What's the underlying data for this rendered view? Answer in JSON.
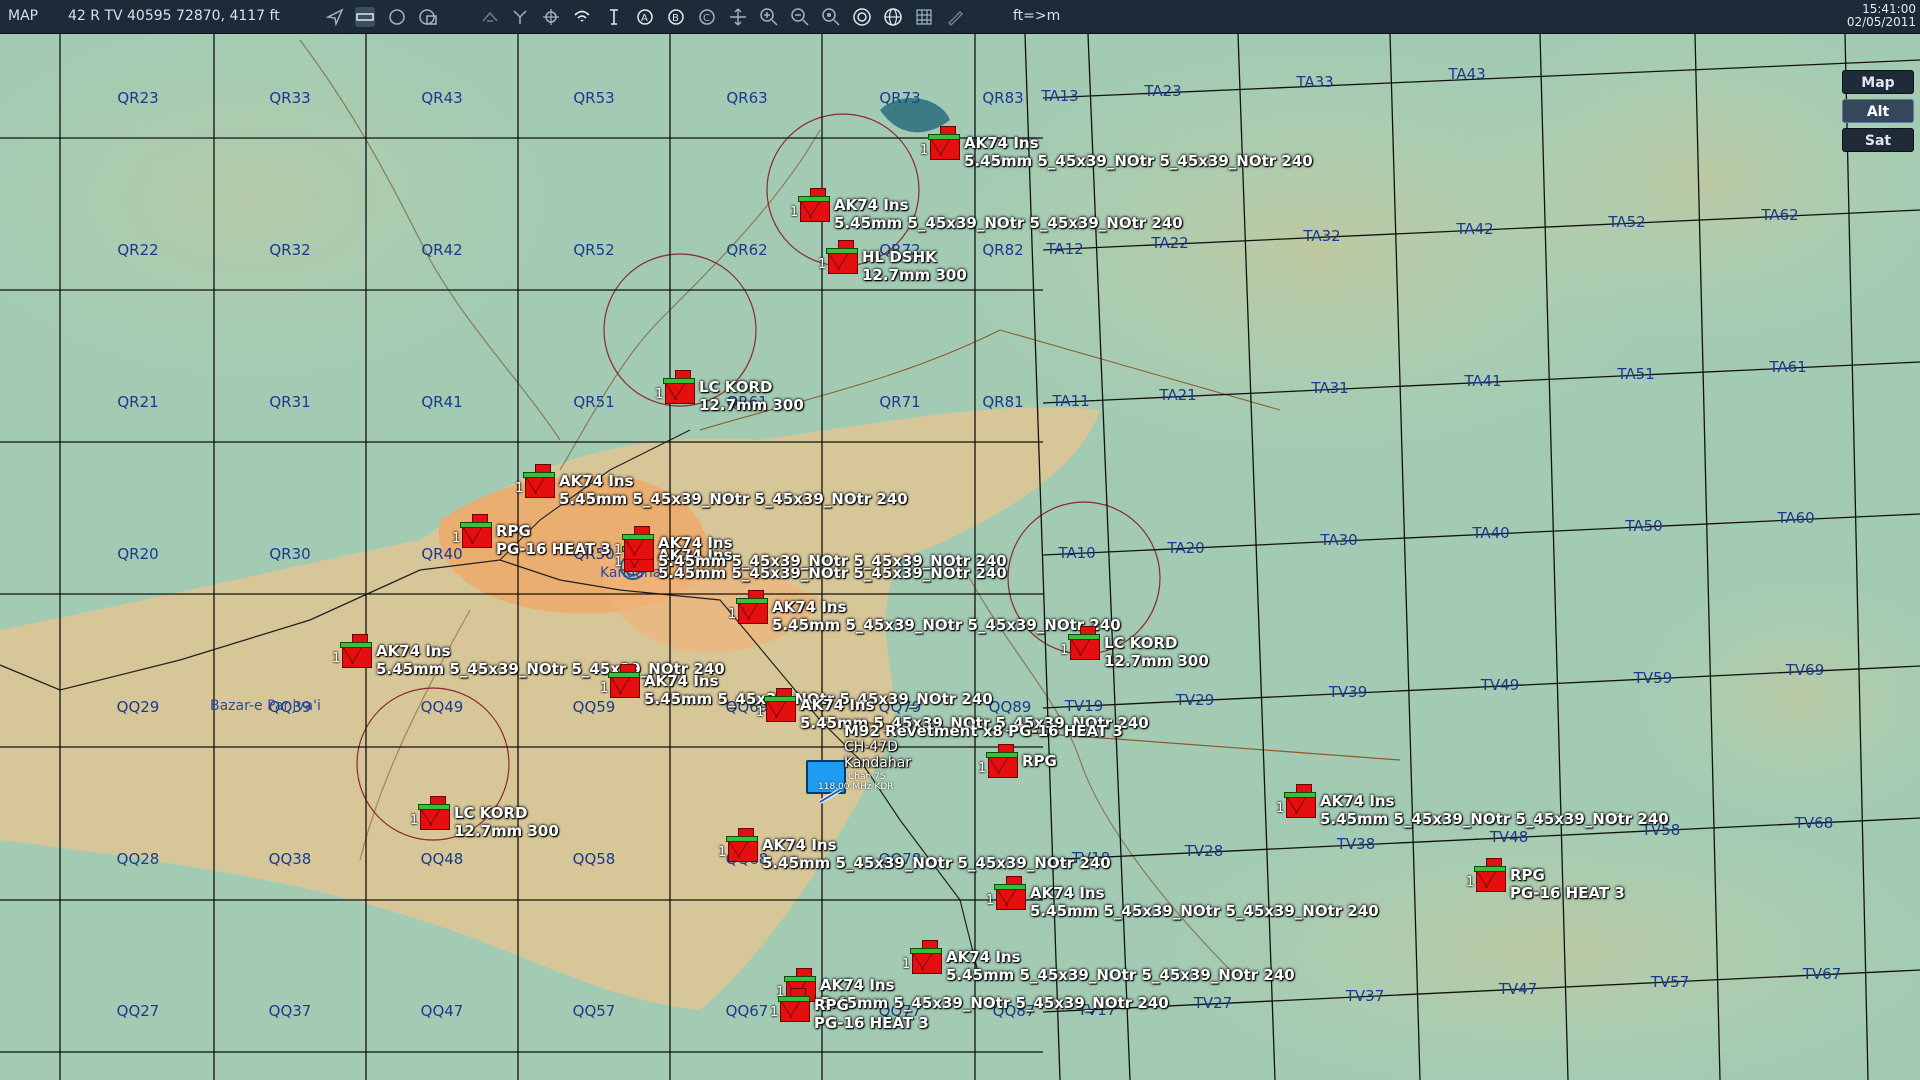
{
  "topbar": {
    "mode_label": "MAP",
    "coordinates": "42 R TV 40595 72870, 4117 ft",
    "units_toggle": "ft=>m",
    "time": "15:41:00",
    "date": "02/05/2011",
    "tool_icons": [
      "pointer-icon",
      "ruler-icon",
      "circle-icon",
      "polygon-icon",
      "aircraft-icon",
      "route-icon",
      "target-icon",
      "wifi-icon",
      "tower-icon",
      "layer-a-icon",
      "layer-b-icon",
      "layer-c-icon",
      "pan-icon",
      "zoom-in-icon",
      "zoom-out-icon",
      "zoom-fit-icon",
      "radar-icon",
      "globe-icon",
      "grid-icon",
      "pencil-icon"
    ]
  },
  "modes": {
    "map": "Map",
    "alt": "Alt",
    "sat": "Sat",
    "active": "Alt"
  },
  "grid_labels": [
    "QR23",
    "QR33",
    "QR43",
    "QR53",
    "QR63",
    "QR73",
    "QR83",
    "TA13",
    "TA23",
    "TA33",
    "TA43",
    "QR22",
    "QR32",
    "QR42",
    "QR52",
    "QR62",
    "QR72",
    "QR82",
    "TA12",
    "TA22",
    "TA32",
    "TA42",
    "TA52",
    "TA62",
    "QR21",
    "QR31",
    "QR41",
    "QR51",
    "QR61",
    "QR71",
    "QR81",
    "TA11",
    "TA21",
    "TA31",
    "TA41",
    "TA51",
    "TA61",
    "QR20",
    "QR30",
    "QR40",
    "QR50",
    "TA10",
    "TA20",
    "TA30",
    "TA40",
    "TA50",
    "TA60",
    "QQ29",
    "QQ39",
    "QQ49",
    "QQ59",
    "QQ69",
    "QQ79",
    "QQ89",
    "TV19",
    "TV29",
    "TV39",
    "TV49",
    "TV59",
    "TV69",
    "QQ28",
    "QQ38",
    "QQ48",
    "QQ58",
    "QQ68",
    "QQ78",
    "TV18",
    "TV28",
    "TV38",
    "TV48",
    "TV58",
    "TV68",
    "QQ27",
    "QQ37",
    "QQ47",
    "QQ57",
    "QQ67",
    "QQ77",
    "QQ87",
    "TV17",
    "TV27",
    "TV37",
    "TV47",
    "TV57",
    "TV67"
  ],
  "towns": {
    "kandahar_city": "Kandahar",
    "bazar": "Bazar-e Panjva'i"
  },
  "friendly": {
    "line1": "M92 Revetment x8 PG-16 HEAT 3",
    "line2": "CH-47D",
    "airport": "Kandahar",
    "freq1": "Chan 75",
    "freq2": "118.00 MHz KDR"
  },
  "units": [
    {
      "count": "1",
      "l1": "AK74 Ins",
      "l2": "5.45mm 5_45x39_NOtr 5_45x39_NOtr  240"
    },
    {
      "count": "1",
      "l1": "AK74 Ins",
      "l2": "5.45mm 5_45x39_NOtr 5_45x39_NOtr  240"
    },
    {
      "count": "1",
      "l1": "HL DSHK",
      "l2": "12.7mm 300"
    },
    {
      "count": "1",
      "l1": "LC KORD",
      "l2": "12.7mm 300"
    },
    {
      "count": "1",
      "l1": "AK74 Ins",
      "l2": "5.45mm 5_45x39_NOtr 5_45x39_NOtr  240"
    },
    {
      "count": "1",
      "l1": "RPG",
      "l2": "PG-16 HEAT 3"
    },
    {
      "count": "1",
      "l1": "AK74 Ins",
      "l2": "5.45mm 5_45x39_NOtr 5_45x39_NOtr  240"
    },
    {
      "count": "1",
      "l1": "AK74 Ins",
      "l2": "5.45mm 5_45x39_NOtr 5_45x39_NOtr  240"
    },
    {
      "count": "1",
      "l1": "LC KORD",
      "l2": "12.7mm 300"
    },
    {
      "count": "1",
      "l1": "AK74 Ins",
      "l2": "5.45mm 5_45x39_NOtr 5_45x39_NOtr  240"
    },
    {
      "count": "1",
      "l1": "AK74 Ins",
      "l2": "5.45mm 5_45x39_NOtr 5_45x39_NOtr  240"
    },
    {
      "count": "1",
      "l1": "AK74 Ins",
      "l2": "5.45mm 5_45x39_NOtr 5_45x39_NOtr  240"
    },
    {
      "count": "1",
      "l1": "AK74 Ins",
      "l2": "5.45mm 5_45x39_NOtr 5_45x39_NOtr  240"
    },
    {
      "count": "1",
      "l1": "RPG",
      "l2": ""
    },
    {
      "count": "1",
      "l1": "LC KORD",
      "l2": "12.7mm 300"
    },
    {
      "count": "1",
      "l1": "AK74 Ins",
      "l2": "5.45mm 5_45x39_NOtr 5_45x39_NOtr  240"
    },
    {
      "count": "1",
      "l1": "AK74 Ins",
      "l2": "5.45mm 5_45x39_NOtr 5_45x39_NOtr  240"
    },
    {
      "count": "1",
      "l1": "AK74 Ins",
      "l2": "5.45mm 5_45x39_NOtr 5_45x39_NOtr  240"
    },
    {
      "count": "1",
      "l1": "AK74 Ins",
      "l2": "5.45mm 5_45x39_NOtr 5_45x39_NOtr  240"
    },
    {
      "count": "1",
      "l1": "RPG",
      "l2": "PG-16 HEAT 3"
    },
    {
      "count": "1",
      "l1": "AK74 Ins",
      "l2": "5.45mm 5_45x39_NOtr 5_45x39_NOtr  240"
    },
    {
      "count": "1",
      "l1": "RPG",
      "l2": "PG-16 HEAT 3"
    }
  ]
}
